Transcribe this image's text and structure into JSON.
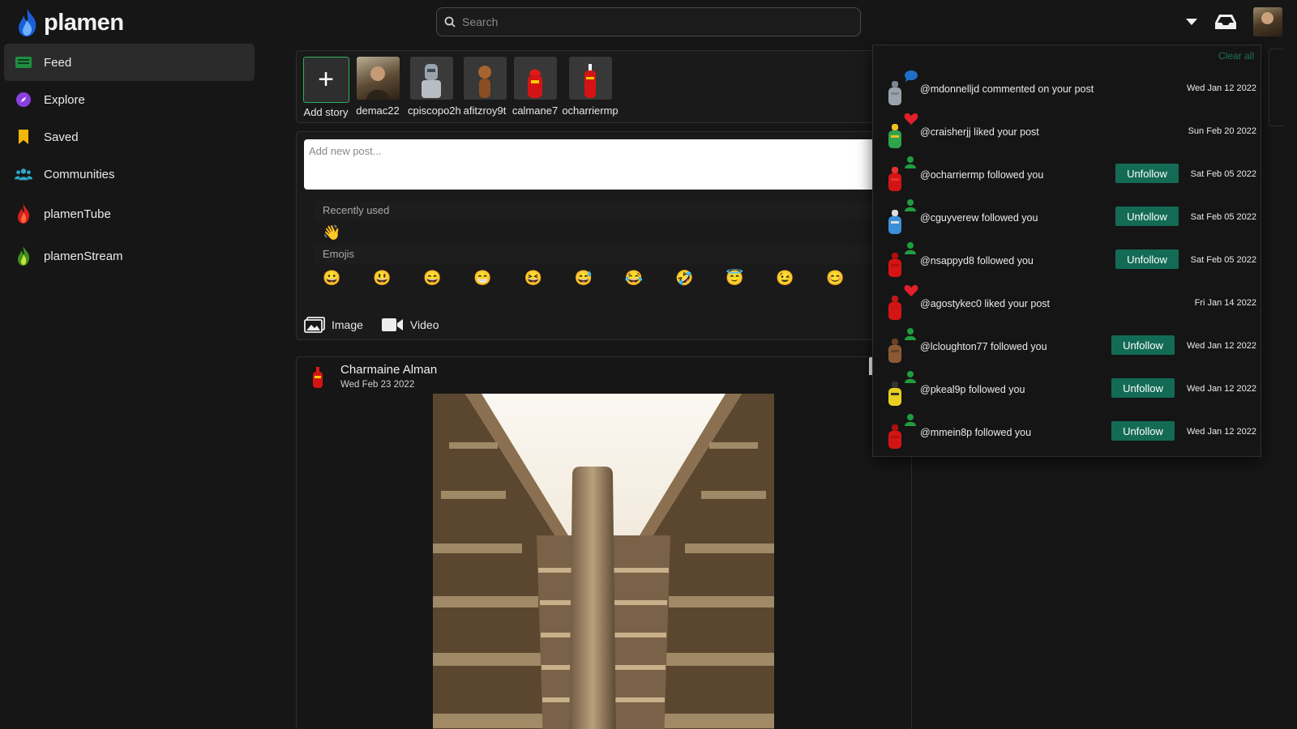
{
  "app": {
    "name": "plamen"
  },
  "search": {
    "placeholder": "Search"
  },
  "sidebar": {
    "items": [
      {
        "label": "Feed",
        "icon": "feed-icon",
        "active": true
      },
      {
        "label": "Explore",
        "icon": "compass-icon"
      },
      {
        "label": "Saved",
        "icon": "bookmark-icon"
      },
      {
        "label": "Communities",
        "icon": "communities-icon"
      },
      {
        "label": "plamenTube",
        "icon": "red-flame-icon"
      },
      {
        "label": "plamenStream",
        "icon": "green-flame-icon"
      }
    ]
  },
  "stories": {
    "add_label": "Add story",
    "users": [
      "demac22",
      "cpiscopo2h",
      "afitzroy9t",
      "calmane7",
      "ocharriermp"
    ]
  },
  "composer": {
    "placeholder": "Add new post...",
    "recently_used_label": "Recently used",
    "recently_used": [
      "👋"
    ],
    "emojis_label": "Emojis",
    "emojis": [
      "😀",
      "😃",
      "😄",
      "😁",
      "😆",
      "😅",
      "😂",
      "🤣",
      "😇",
      "😉",
      "😊",
      "🙂"
    ],
    "image_label": "Image",
    "video_label": "Video"
  },
  "post": {
    "author": "Charmaine Alman",
    "date": "Wed Feb 23 2022"
  },
  "notifications": {
    "clear_label": "Clear all",
    "unfollow_label": "Unfollow",
    "items": [
      {
        "text": "@mdonnelljd commented on your post",
        "date": "Wed Jan 12 2022",
        "type": "comment",
        "follow": false
      },
      {
        "text": "@craisherjj liked your post",
        "date": "Sun Feb 20 2022",
        "type": "like",
        "follow": false
      },
      {
        "text": "@ocharriermp followed you",
        "date": "Sat Feb 05 2022",
        "type": "follow",
        "follow": true
      },
      {
        "text": "@cguyverew followed you",
        "date": "Sat Feb 05 2022",
        "type": "follow",
        "follow": true
      },
      {
        "text": "@nsappyd8 followed you",
        "date": "Sat Feb 05 2022",
        "type": "follow",
        "follow": true
      },
      {
        "text": "@agostykec0 liked your post",
        "date": "Fri Jan 14 2022",
        "type": "like",
        "follow": false
      },
      {
        "text": "@lcloughton77 followed you",
        "date": "Wed Jan 12 2022",
        "type": "follow",
        "follow": true
      },
      {
        "text": "@pkeal9p followed you",
        "date": "Wed Jan 12 2022",
        "type": "follow",
        "follow": true
      },
      {
        "text": "@mmein8p followed you",
        "date": "Wed Jan 12 2022",
        "type": "follow",
        "follow": true
      }
    ]
  },
  "colors": {
    "background": "#161616",
    "accent_green": "#136b56",
    "link_teal": "#1f6f5c",
    "like_red": "#e0202a",
    "follow_green": "#1f9d3f",
    "comment_blue": "#1f6fc8"
  }
}
